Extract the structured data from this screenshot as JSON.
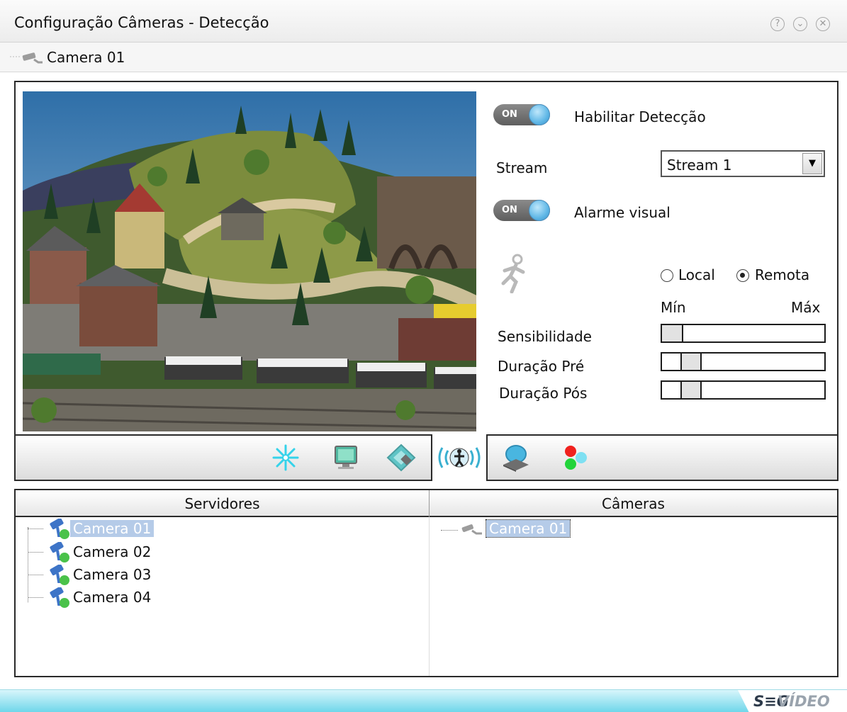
{
  "window": {
    "title": "Configuração Câmeras - Detecção",
    "buttons": [
      "help-icon",
      "minimize-icon",
      "close-icon"
    ]
  },
  "subheader": {
    "camera_name": "Camera 01",
    "icon": "camera-icon"
  },
  "detection": {
    "enable_toggle": {
      "state": "ON",
      "label": "Habilitar Detecção"
    },
    "stream": {
      "label": "Stream",
      "selected": "Stream 1"
    },
    "visual_alarm_toggle": {
      "state": "ON",
      "label": "Alarme visual"
    },
    "mode_icon": "running-person-icon",
    "mode": {
      "options": [
        "Local",
        "Remota"
      ],
      "selected": "Remota"
    },
    "scale": {
      "min": "Mín",
      "max": "Máx"
    },
    "sliders": [
      {
        "label": "Sensibilidade",
        "level": 0.0
      },
      {
        "label": "Duração Pré",
        "level": 0.12
      },
      {
        "label": "Duração Pós",
        "level": 0.12
      }
    ]
  },
  "toolbar": {
    "tools": [
      "snowflake-icon",
      "monitor-icon",
      "disk-icon",
      "motion-detection-icon",
      "server-icon",
      "color-dots-icon"
    ],
    "active": "motion-detection-icon"
  },
  "lists": {
    "servers": {
      "header": "Servidores",
      "items": [
        "Camera 01",
        "Camera 02",
        "Camera 03",
        "Camera 04"
      ],
      "selected": "Camera 01"
    },
    "cameras": {
      "header": "Câmeras",
      "items": [
        "Camera 01"
      ],
      "selected": "Camera 01"
    }
  },
  "footer": {
    "brand_a": "S≡G",
    "brand_b": "VÍDEO"
  },
  "colors": {
    "accent": "#5fb7e6",
    "selection": "#b5cbe8",
    "footer": "#6fd7ea"
  }
}
